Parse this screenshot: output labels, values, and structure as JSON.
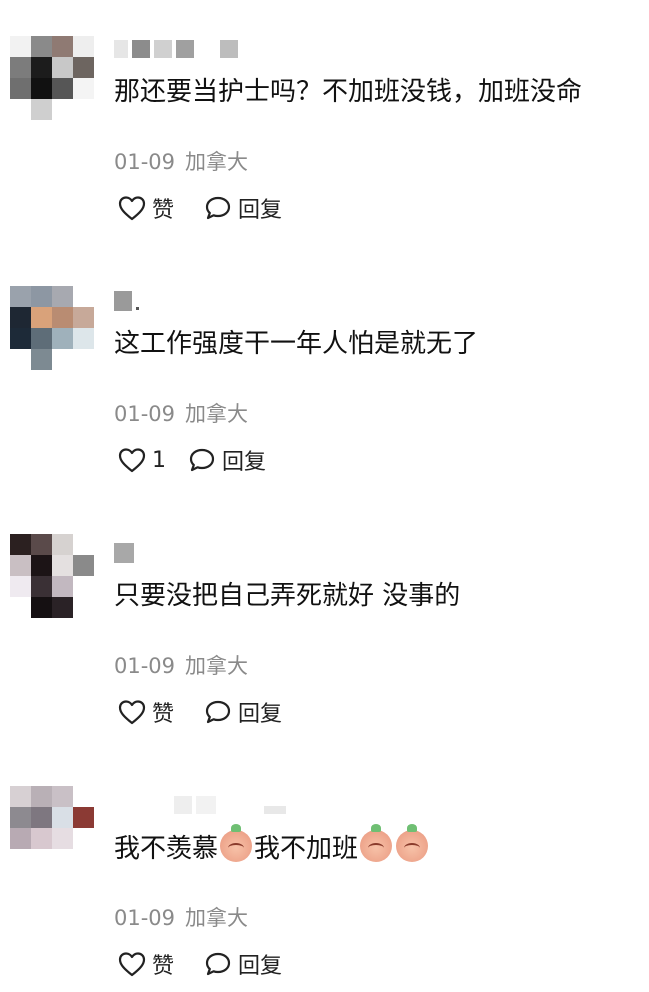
{
  "comments": [
    {
      "text": "那还要当护士吗？不加班没钱，加班没命",
      "date": "01-09",
      "location": "加拿大",
      "like_label": "赞",
      "reply_label": "回复"
    },
    {
      "text": "这工作强度干一年人怕是就无了",
      "date": "01-09",
      "location": "加拿大",
      "like_label": "1",
      "reply_label": "回复"
    },
    {
      "text": "只要没把自己弄死就好 没事的",
      "date": "01-09",
      "location": "加拿大",
      "like_label": "赞",
      "reply_label": "回复"
    },
    {
      "text_parts": [
        "我不羡慕",
        "我不加班"
      ],
      "date": "01-09",
      "location": "加拿大",
      "like_label": "赞",
      "reply_label": "回复"
    }
  ],
  "icons": {
    "like": "heart-icon",
    "reply": "speech-bubble-icon",
    "emoji": "peach-face-emoji"
  }
}
